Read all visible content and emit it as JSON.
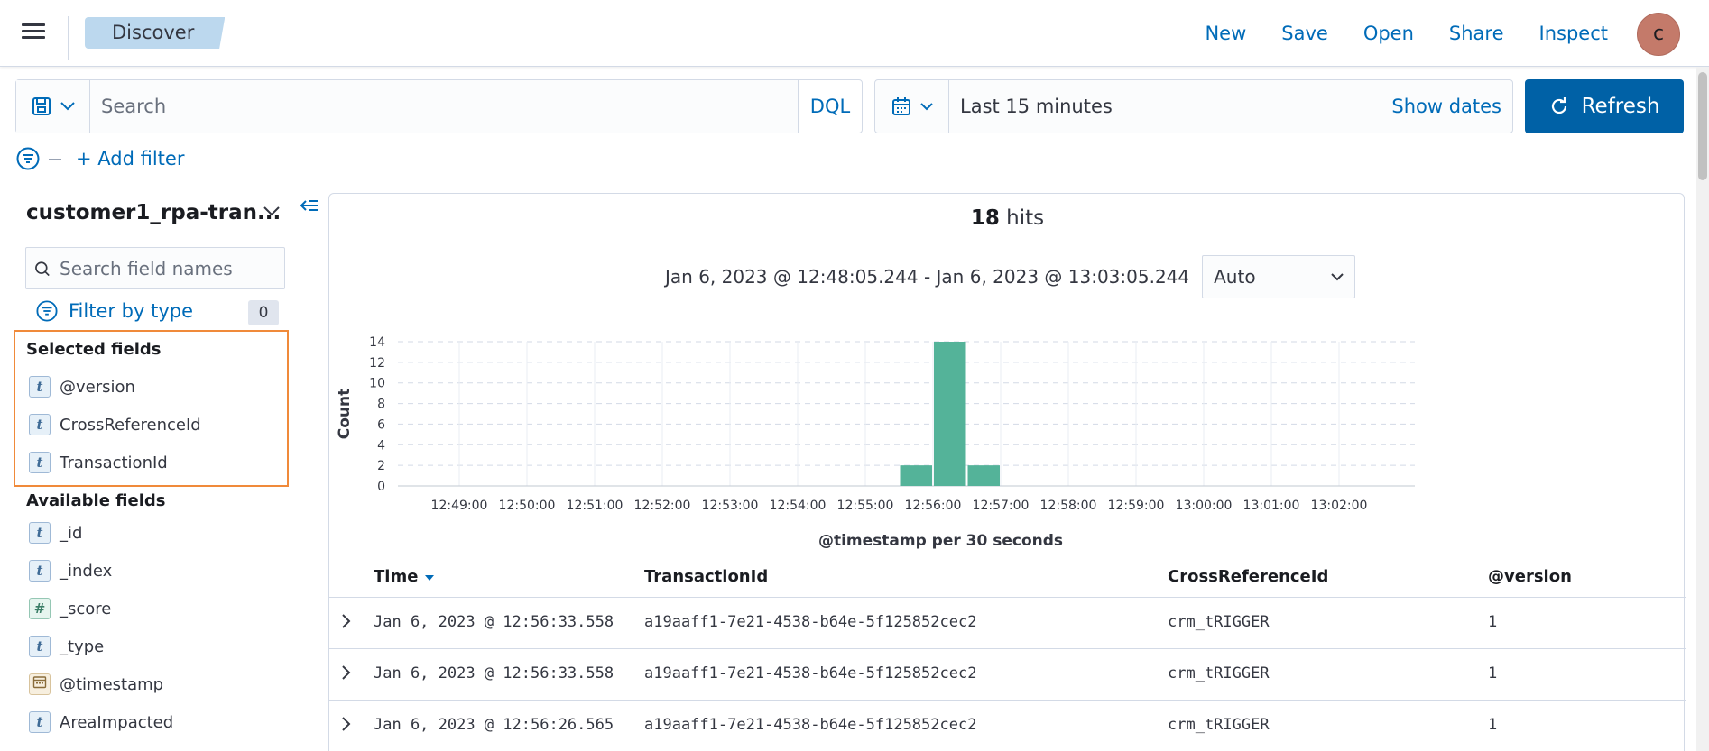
{
  "header": {
    "breadcrumb": "Discover",
    "links": [
      "New",
      "Save",
      "Open",
      "Share",
      "Inspect"
    ],
    "avatar_initial": "c"
  },
  "query": {
    "search_placeholder": "Search",
    "language": "DQL",
    "time_range": "Last 15 minutes",
    "show_dates": "Show dates",
    "refresh_label": "Refresh",
    "add_filter": "+ Add filter"
  },
  "sidebar": {
    "index_pattern": "customer1_rpa-tran...",
    "field_search_placeholder": "Search field names",
    "filter_by_type": "Filter by type",
    "filter_count": "0",
    "selected_title": "Selected fields",
    "selected_fields": [
      {
        "name": "@version",
        "type": "t"
      },
      {
        "name": "CrossReferenceId",
        "type": "t"
      },
      {
        "name": "TransactionId",
        "type": "t"
      }
    ],
    "available_title": "Available fields",
    "available_fields": [
      {
        "name": "_id",
        "type": "t"
      },
      {
        "name": "_index",
        "type": "t"
      },
      {
        "name": "_score",
        "type": "#"
      },
      {
        "name": "_type",
        "type": "t"
      },
      {
        "name": "@timestamp",
        "type": "date"
      },
      {
        "name": "AreaImpacted",
        "type": "t"
      }
    ]
  },
  "main": {
    "hits_count": "18",
    "hits_label": "hits",
    "range_text": "Jan 6, 2023 @ 12:48:05.244 - Jan 6, 2023 @ 13:03:05.244",
    "interval": "Auto",
    "table": {
      "headers": [
        "Time",
        "TransactionId",
        "CrossReferenceId",
        "@version"
      ],
      "rows": [
        [
          "Jan 6, 2023 @ 12:56:33.558",
          "a19aaff1-7e21-4538-b64e-5f125852cec2",
          "crm_tRIGGER",
          "1"
        ],
        [
          "Jan 6, 2023 @ 12:56:33.558",
          "a19aaff1-7e21-4538-b64e-5f125852cec2",
          "crm_tRIGGER",
          "1"
        ],
        [
          "Jan 6, 2023 @ 12:56:26.565",
          "a19aaff1-7e21-4538-b64e-5f125852cec2",
          "crm_tRIGGER",
          "1"
        ]
      ]
    }
  },
  "colors": {
    "accent": "#006bb8",
    "bar": "#54b399",
    "refresh_bg": "#0061a6",
    "highlight_border": "#f08a3a"
  },
  "chart_data": {
    "type": "bar",
    "ylabel": "Count",
    "xlabel": "@timestamp per 30 seconds",
    "ylim": [
      0,
      14
    ],
    "yticks": [
      0,
      2,
      4,
      6,
      8,
      10,
      12,
      14
    ],
    "xticks": [
      "12:49:00",
      "12:50:00",
      "12:51:00",
      "12:52:00",
      "12:53:00",
      "12:54:00",
      "12:55:00",
      "12:56:00",
      "12:57:00",
      "12:58:00",
      "12:59:00",
      "13:00:00",
      "13:01:00",
      "13:02:00"
    ],
    "bars": [
      {
        "start": "12:55:30",
        "value": 2
      },
      {
        "start": "12:56:00",
        "value": 14
      },
      {
        "start": "12:56:30",
        "value": 2
      }
    ],
    "grid": true
  }
}
